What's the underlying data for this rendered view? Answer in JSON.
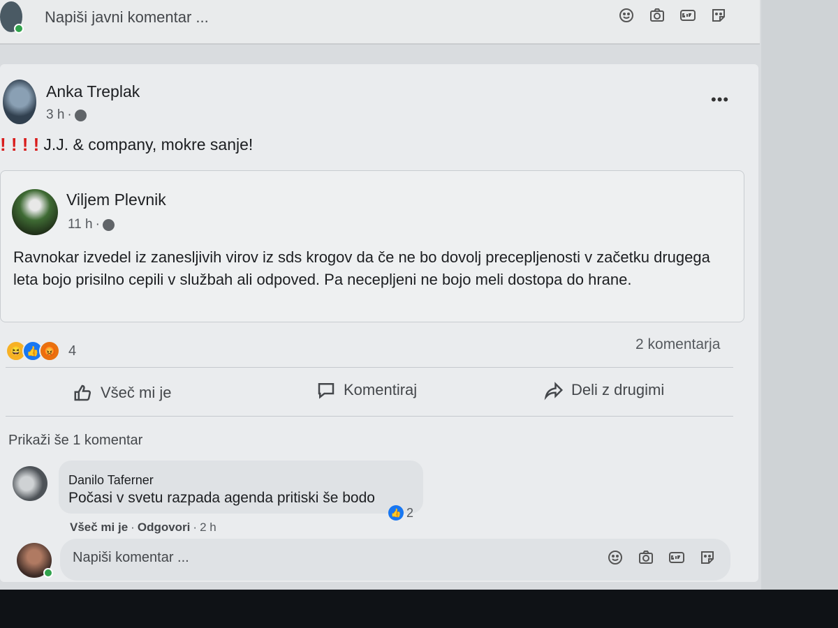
{
  "top_composer": {
    "placeholder": "Napiši javni komentar ...",
    "icons": [
      "emoji-icon",
      "camera-icon",
      "gif-icon",
      "sticker-icon"
    ]
  },
  "post": {
    "author": "Anka Treplak",
    "time": "3 h",
    "privacy_icon": "globe-icon",
    "more_label": "•••",
    "text_prefix": "! ! ! !",
    "text": "J.J. & company, mokre sanje!"
  },
  "shared_post": {
    "author": "Viljem Plevnik",
    "time": "11 h",
    "privacy_icon": "globe-icon",
    "body": "Ravnokar izvedel iz zanesljivih virov iz sds krogov da če ne bo dovolj precepljenosti v začetku drugega leta bojo prisilno cepili v službah ali odpoved. Pa necepljeni ne bojo meli dostopa do hrane."
  },
  "reactions": {
    "types": [
      "haha",
      "like",
      "angry"
    ],
    "count": "4",
    "comments": "2 komentarja"
  },
  "actions": {
    "like": "Všeč mi je",
    "comment": "Komentiraj",
    "share": "Deli z drugimi"
  },
  "show_more": "Prikaži še 1 komentar",
  "comment": {
    "author": "Danilo Taferner",
    "text": "Počasi v svetu razpada agenda pritiski še bodo",
    "likes": "2",
    "like_label": "Všeč mi je",
    "reply_label": "Odgovori",
    "time": "2 h",
    "separator": "·"
  },
  "bottom_composer": {
    "placeholder": "Napiši komentar ..."
  },
  "colors": {
    "like_blue": "#1877f2",
    "online_green": "#31a24c",
    "exclamation_red": "#d81b1b"
  }
}
